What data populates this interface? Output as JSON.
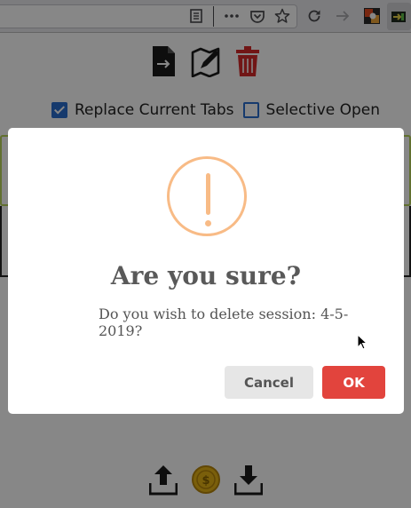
{
  "toolbar": {
    "icons": [
      "reader-view-icon",
      "more-actions-icon",
      "pocket-icon",
      "bookmark-star-icon",
      "reload-icon",
      "forward-arrow-icon",
      "extension-icon",
      "session-extension-icon"
    ]
  },
  "popup": {
    "top_icons": [
      "open-session-icon",
      "edit-session-icon",
      "delete-session-icon"
    ],
    "options": {
      "replace_current_tabs": {
        "label": "Replace Current Tabs",
        "checked": true
      },
      "selective_open": {
        "label": "Selective Open",
        "checked": false
      }
    },
    "bottom_icons": [
      "upload-icon",
      "donate-coin-icon",
      "download-icon"
    ]
  },
  "dialog": {
    "icon": "warning-icon",
    "title": "Are you sure?",
    "text": "Do you wish to delete session: 4-5-2019?",
    "cancel_label": "Cancel",
    "ok_label": "OK"
  },
  "colors": {
    "warning": "#f8bb86",
    "confirm_button": "#e2443d",
    "cancel_button": "#e6e6e6",
    "delete_icon": "#d62b2b",
    "checkbox": "#2a6ecf",
    "session_border_green": "#b7d35a"
  }
}
